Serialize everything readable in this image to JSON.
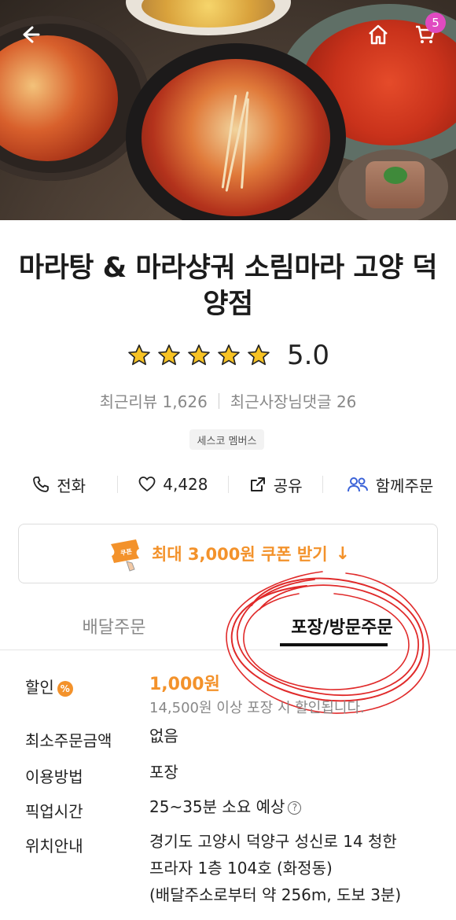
{
  "header": {
    "cart_count": "5"
  },
  "store": {
    "title": "마라탕 & 마라샹궈 소림마라 고양 덕양점",
    "rating_value": "5.0",
    "rating_stars": 5,
    "recent_reviews_label": "최근리뷰 1,626",
    "owner_replies_label": "최근사장님댓글 26",
    "badge": "세스코 멤버스"
  },
  "actions": {
    "call_label": "전화",
    "like_count": "4,428",
    "share_label": "공유",
    "group_order_label": "함께주문"
  },
  "coupon": {
    "text": "최대 3,000원 쿠폰 받기",
    "icon_text": "쿠폰",
    "arrow": "↓"
  },
  "tabs": [
    {
      "label": "배달주문",
      "active": false
    },
    {
      "label": "포장/방문주문",
      "active": true
    }
  ],
  "info": {
    "discount_label": "할인",
    "discount_badge": "%",
    "discount_value": "1,000원",
    "discount_note": "14,500원 이상 포장 시 할인됩니다.",
    "min_order_label": "최소주문금액",
    "min_order_value": "없음",
    "method_label": "이용방법",
    "method_value": "포장",
    "pickup_label": "픽업시간",
    "pickup_value": "25~35분 소요 예상",
    "location_label": "위치안내",
    "location_line1": "경기도 고양시 덕양구 성신로 14 청한",
    "location_line2": "프라자 1층 104호 (화정동)",
    "location_line3": "(배달주소로부터 약 256m, 도보 3분)"
  },
  "colors": {
    "accent": "#f3922b",
    "badge": "#e04ac0",
    "scribble": "#e02a2a"
  }
}
